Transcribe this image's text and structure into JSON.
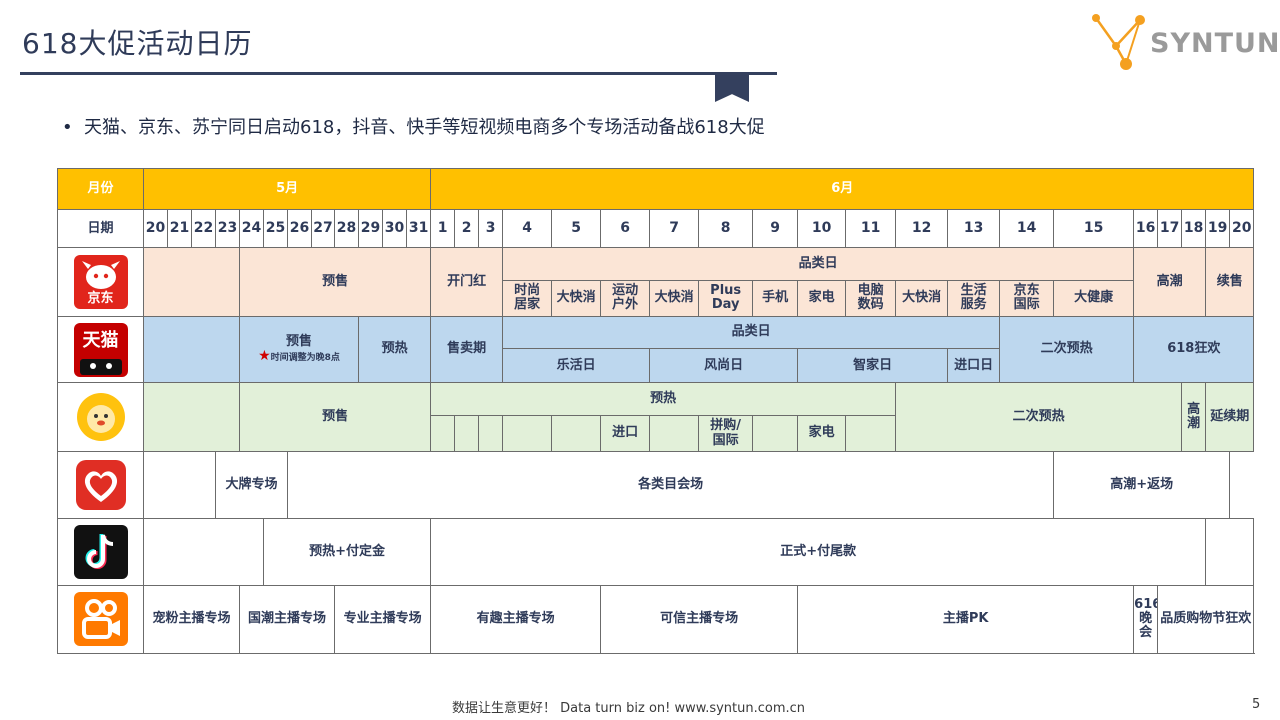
{
  "slide": {
    "title": "618大促活动日历",
    "bullet": "天猫、京东、苏宁同日启动618，抖音、快手等短视频电商多个专场活动备战618大促",
    "brand": "SYNTUN",
    "footer": "数据让生意更好！ Data turn biz on!  www.syntun.com.cn",
    "page": "5"
  },
  "header": {
    "month_label": "月份",
    "may": "5月",
    "june": "6月",
    "date_label": "日期",
    "may_days": [
      "20",
      "21",
      "22",
      "23",
      "24",
      "25",
      "26",
      "27",
      "28",
      "29",
      "30",
      "31"
    ],
    "june_days": [
      "1",
      "2",
      "3",
      "4",
      "5",
      "6",
      "7",
      "8",
      "9",
      "10",
      "11",
      "12",
      "13",
      "14",
      "15",
      "16",
      "17",
      "18",
      "19",
      "20"
    ]
  },
  "jd": {
    "icon_text": "京东",
    "presale": "预售",
    "kaimen": "开门红",
    "category_day": "品类日",
    "cats": [
      "时尚\n居家",
      "大快消",
      "运动\n户外",
      "大快消",
      "Plus\nDay",
      "手机",
      "家电",
      "电脑\n数码",
      "大快消",
      "生活\n服务",
      "京东\n国际",
      "大健康"
    ],
    "climax": "高潮",
    "continue": "续售"
  },
  "tmall": {
    "icon_text": "天猫",
    "presale": "预售",
    "note": "时间调整为晚8点",
    "preheat": "预热",
    "selling": "售卖期",
    "category_day": "品类日",
    "cats": [
      "乐活日",
      "风尚日",
      "智家日",
      "进口日"
    ],
    "second_preheat": "二次预热",
    "carnival": "618狂欢"
  },
  "suning": {
    "presale": "预售",
    "preheat": "预热",
    "cats": [
      "进口",
      "拼购/\n国际",
      "家电"
    ],
    "second_preheat": "二次预热",
    "climax": "高\n潮",
    "extend": "延续期"
  },
  "pdd": {
    "brand_special": "大牌专场",
    "category_venue": "各类目会场",
    "climax_return": "高潮+返场"
  },
  "douyin": {
    "preheat_deposit": "预热+付定金",
    "formal_balance": "正式+付尾款"
  },
  "kuaishou": {
    "sessions": [
      "宠粉主播专场",
      "国潮主播专场",
      "专业主播专场",
      "有趣主播专场",
      "可信主播专场",
      "主播PK",
      "616\n晚会",
      "品质购物节狂欢"
    ]
  },
  "colors": {
    "header_yellow": "#ffc000",
    "jd_pink": "#fbe5d6",
    "tmall_blue": "#bdd7ee",
    "suning_green": "#e2f0d9",
    "navy": "#34405e"
  }
}
